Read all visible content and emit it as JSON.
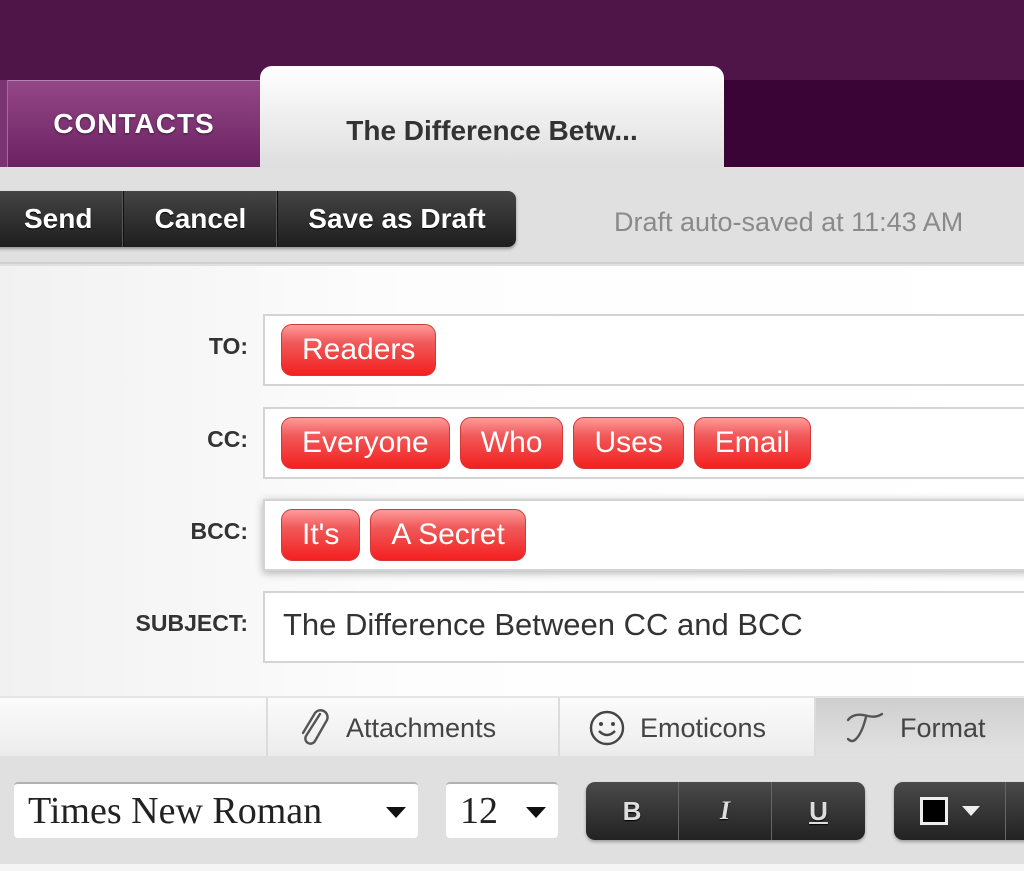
{
  "tabs": [
    {
      "label": "CONTACTS",
      "active": false
    },
    {
      "label": "The Difference Betw...",
      "active": true
    }
  ],
  "toolbar": {
    "send_label": "Send",
    "cancel_label": "Cancel",
    "save_draft_label": "Save as Draft",
    "autosave_status": "Draft auto-saved at 11:43 AM"
  },
  "compose": {
    "to": {
      "label": "TO:",
      "recipients": [
        "Readers"
      ]
    },
    "cc": {
      "label": "CC:",
      "recipients": [
        "Everyone",
        "Who",
        "Uses",
        "Email"
      ]
    },
    "bcc": {
      "label": "BCC:",
      "recipients": [
        "It's",
        "A Secret"
      ]
    },
    "subject": {
      "label": "SUBJECT:",
      "value": "The Difference Between CC and BCC"
    }
  },
  "attach_bar": {
    "attachments_label": "Attachments",
    "emoticons_label": "Emoticons",
    "format_label": "Format",
    "attachments_icon": "paperclip-icon",
    "emoticons_icon": "smiley-icon",
    "format_icon": "script-t-icon"
  },
  "format_bar": {
    "font_family": "Times New Roman",
    "font_size": "12",
    "bold_label": "B",
    "italic_label": "I",
    "underline_label": "U",
    "text_color": "#000000"
  },
  "colors": {
    "brand_purple": "#4f1549",
    "chip_red": "#f41f1f"
  }
}
